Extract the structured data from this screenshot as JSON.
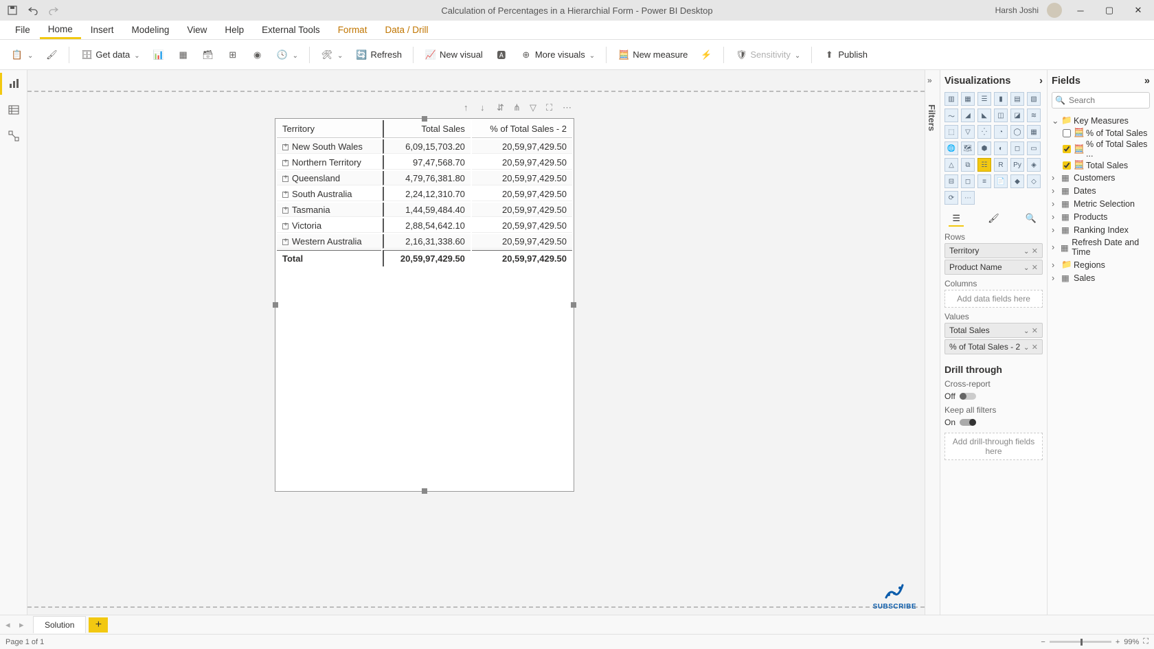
{
  "titlebar": {
    "title": "Calculation of Percentages in a Hierarchial Form - Power BI Desktop",
    "user": "Harsh Joshi"
  },
  "menus": {
    "file": "File",
    "home": "Home",
    "insert": "Insert",
    "modeling": "Modeling",
    "view": "View",
    "help": "Help",
    "external": "External Tools",
    "format": "Format",
    "datadrill": "Data / Drill"
  },
  "ribbon": {
    "getdata": "Get data",
    "refresh": "Refresh",
    "newvisual": "New visual",
    "morevisuals": "More visuals",
    "newmeasure": "New measure",
    "sensitivity": "Sensitivity",
    "publish": "Publish"
  },
  "matrix": {
    "headers": {
      "territory": "Territory",
      "totalsales": "Total Sales",
      "pct": "% of Total Sales - 2"
    },
    "rows": [
      {
        "territory": "New South Wales",
        "totalsales": "6,09,15,703.20",
        "pct": "20,59,97,429.50"
      },
      {
        "territory": "Northern Territory",
        "totalsales": "97,47,568.70",
        "pct": "20,59,97,429.50"
      },
      {
        "territory": "Queensland",
        "totalsales": "4,79,76,381.80",
        "pct": "20,59,97,429.50"
      },
      {
        "territory": "South Australia",
        "totalsales": "2,24,12,310.70",
        "pct": "20,59,97,429.50"
      },
      {
        "territory": "Tasmania",
        "totalsales": "1,44,59,484.40",
        "pct": "20,59,97,429.50"
      },
      {
        "territory": "Victoria",
        "totalsales": "2,88,54,642.10",
        "pct": "20,59,97,429.50"
      },
      {
        "territory": "Western Australia",
        "totalsales": "2,16,31,338.60",
        "pct": "20,59,97,429.50"
      }
    ],
    "total": {
      "label": "Total",
      "totalsales": "20,59,97,429.50",
      "pct": "20,59,97,429.50"
    }
  },
  "viz": {
    "title": "Visualizations",
    "rows_label": "Rows",
    "rows": {
      "territory": "Territory",
      "product": "Product Name"
    },
    "columns_label": "Columns",
    "columns_placeholder": "Add data fields here",
    "values_label": "Values",
    "values": {
      "totalsales": "Total Sales",
      "pct": "% of Total Sales - 2"
    },
    "drill_title": "Drill through",
    "crossreport_label": "Cross-report",
    "crossreport_state": "Off",
    "keepfilters_label": "Keep all filters",
    "keepfilters_state": "On",
    "drill_placeholder": "Add drill-through fields here"
  },
  "fields": {
    "title": "Fields",
    "search_placeholder": "Search",
    "tables": {
      "keymeasures": "Key Measures",
      "km_pct1": "% of Total Sales",
      "km_pct2": "% of Total Sales ...",
      "km_totalsales": "Total Sales",
      "customers": "Customers",
      "dates": "Dates",
      "metricselection": "Metric Selection",
      "products": "Products",
      "rankingindex": "Ranking Index",
      "refreshdate": "Refresh Date and Time",
      "regions": "Regions",
      "sales": "Sales"
    }
  },
  "filters": {
    "label": "Filters"
  },
  "pagebar": {
    "tab": "Solution"
  },
  "status": {
    "page": "Page 1 of 1",
    "zoom": "99%"
  },
  "subscribe": {
    "label": "SUBSCRIBE"
  }
}
